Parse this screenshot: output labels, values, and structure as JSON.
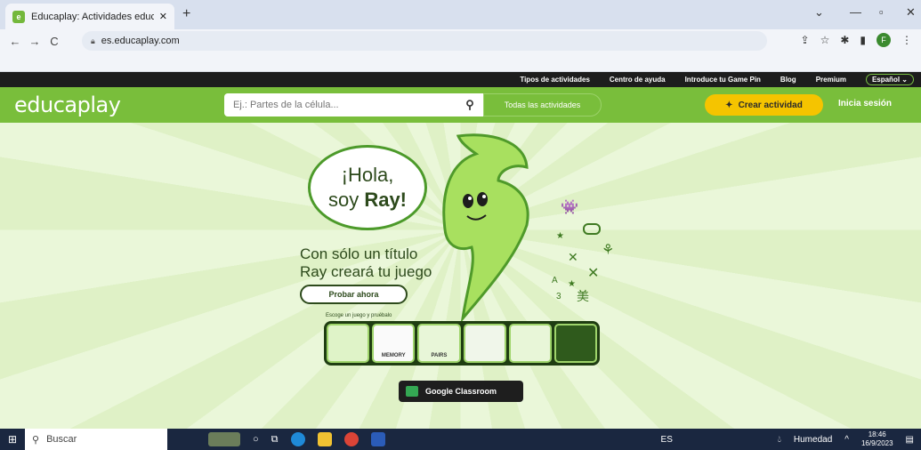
{
  "browser": {
    "tab_title": "Educaplay: Actividades educativa",
    "url": "es.educaplay.com",
    "profile_initial": "F"
  },
  "site": {
    "top_links": [
      "Tipos de actividades",
      "Centro de ayuda",
      "Introduce tu Game Pin",
      "Blog",
      "Premium"
    ],
    "language": "Español",
    "logo": "educaplay",
    "search_placeholder": "Ej.: Partes de la célula...",
    "categories_label": "Todas las actividades",
    "create_label": "Crear actividad",
    "login_label": "Inicia sesión"
  },
  "hero": {
    "greeting_line1": "¡Hola,",
    "greeting_prefix": "soy ",
    "greeting_name": "Ray!",
    "pitch_line1": "Con sólo un título",
    "pitch_line2": "Ray creará tu juego",
    "try_label": "Probar ahora",
    "pick_label": "Escoge un juego y pruébalo",
    "games": [
      "",
      "MEMORY",
      "PAIRS",
      "",
      "",
      ""
    ],
    "classroom_label": "Google Classroom"
  },
  "taskbar": {
    "search_label": "Buscar",
    "lang": "ES",
    "weather": "Humedad",
    "time": "18:46",
    "date": "16/9/2023"
  }
}
